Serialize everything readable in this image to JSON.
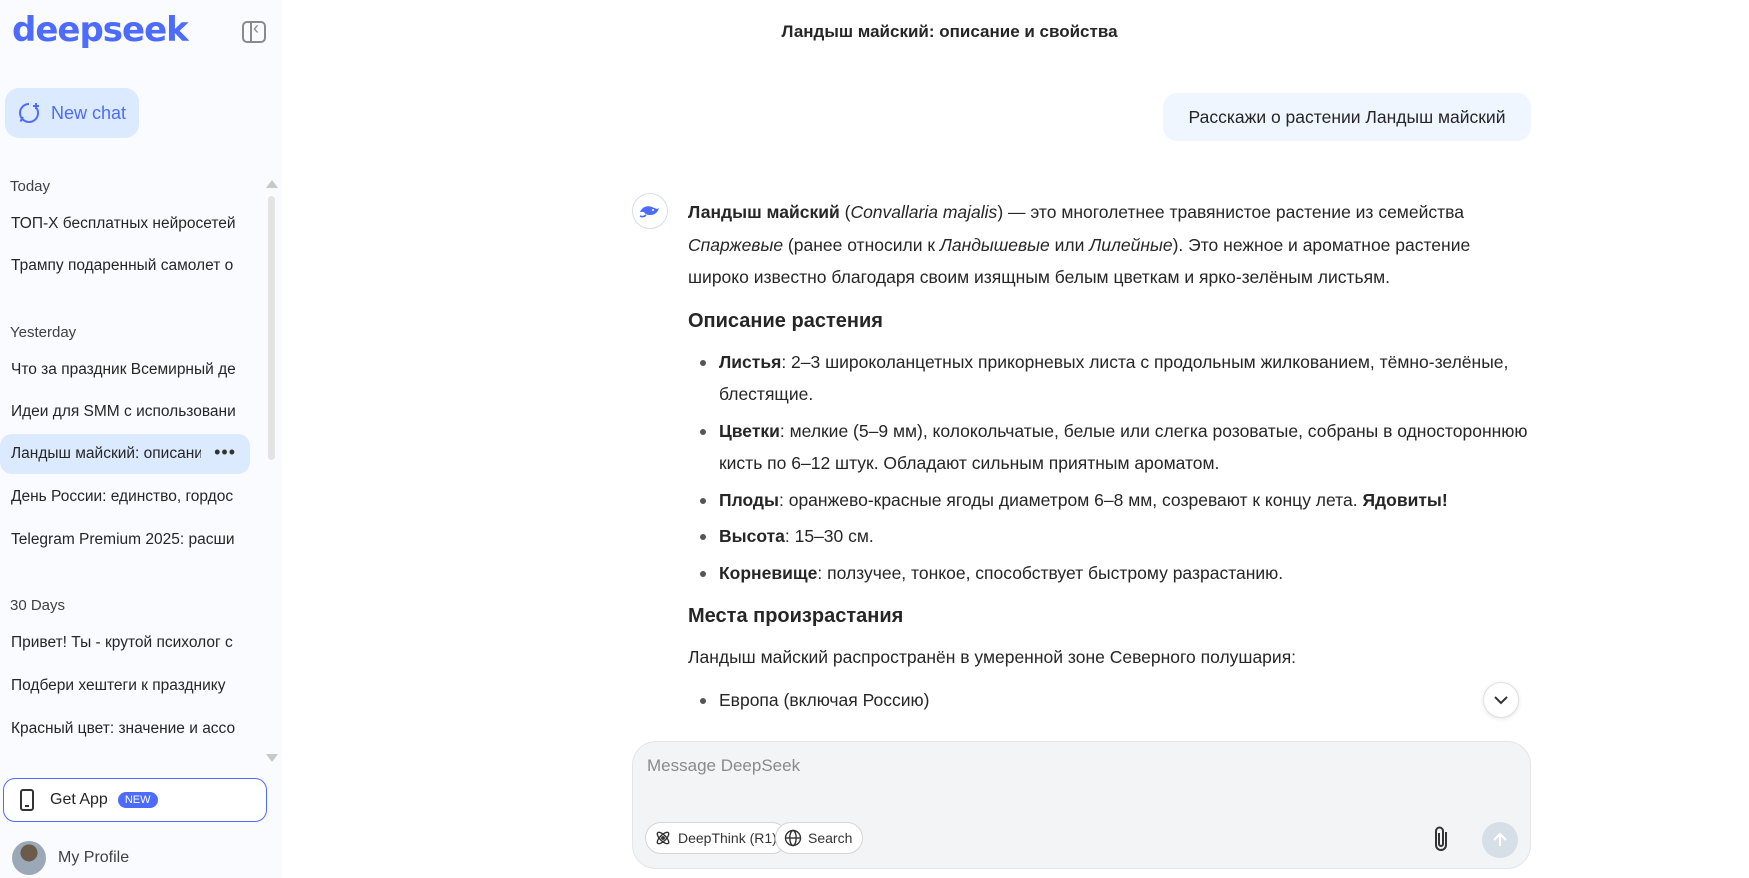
{
  "sidebar": {
    "logo": "deepseek",
    "new_chat_label": "New chat",
    "sections": [
      {
        "label": "Today",
        "items": [
          "ТОП-Х бесплатных нейросетей",
          "Трампу подаренный самолет о"
        ]
      },
      {
        "label": "Yesterday",
        "items": [
          "Что за праздник Всемирный де",
          "Идеи для SMM с использовани",
          "Ландыш майский: описание",
          "День России: единство, гордос",
          "Telegram Premium 2025: расши"
        ]
      },
      {
        "label": "30 Days",
        "items": [
          "Привет! Ты - крутой психолог с",
          "Подбери хештеги к празднику",
          "Красный цвет: значение и ассо"
        ]
      }
    ],
    "active_dots": "•••",
    "get_app_label": "Get App",
    "get_app_badge": "NEW",
    "profile_label": "My Profile"
  },
  "chat": {
    "title": "Ландыш майский: описание и свойства",
    "user_message": "Расскажи о растении Ландыш майский",
    "intro": {
      "b1": "Ландыш майский",
      "t1": " (",
      "i1": "Convallaria majalis",
      "t2": ") — это многолетнее травянистое растение из семейства ",
      "i2": "Спаржевые",
      "t3": " (ранее относили к ",
      "i3": "Ландышевые",
      "t4": " или ",
      "i4": "Лилейные",
      "t5": "). Это нежное и ароматное растение широко известно благодаря своим изящным белым цветкам и ярко-зелёным листьям."
    },
    "h_description": "Описание растения",
    "description_items": [
      {
        "term": "Листья",
        "text": ": 2–3 широколанцетных прикорневых листа с продольным жилкованием, тёмно-зелёные, блестящие."
      },
      {
        "term": "Цветки",
        "text": ": мелкие (5–9 мм), колокольчатые, белые или слегка розоватые, собраны в одностороннюю кисть по 6–12 штук. Обладают сильным приятным ароматом."
      },
      {
        "term": "Плоды",
        "text": ": оранжево-красные ягоды диаметром 6–8 мм, созревают к концу лета. ",
        "strong": "Ядовиты!"
      },
      {
        "term": "Высота",
        "text": ": 15–30 см."
      },
      {
        "term": "Корневище",
        "text": ": ползучее, тонкое, способствует быстрому разрастанию."
      }
    ],
    "h_habitat": "Места произрастания",
    "habitat_text": "Ландыш майский распространён в умеренной зоне Северного полушария:",
    "habitat_items": [
      "Европа (включая Россию)"
    ]
  },
  "composer": {
    "placeholder": "Message DeepSeek",
    "deepthink_label": "DeepThink (R1)",
    "search_label": "Search"
  },
  "colors": {
    "accent": "#4d6bfe",
    "active_bg": "#dbeafe",
    "user_bubble": "#eff6ff"
  }
}
